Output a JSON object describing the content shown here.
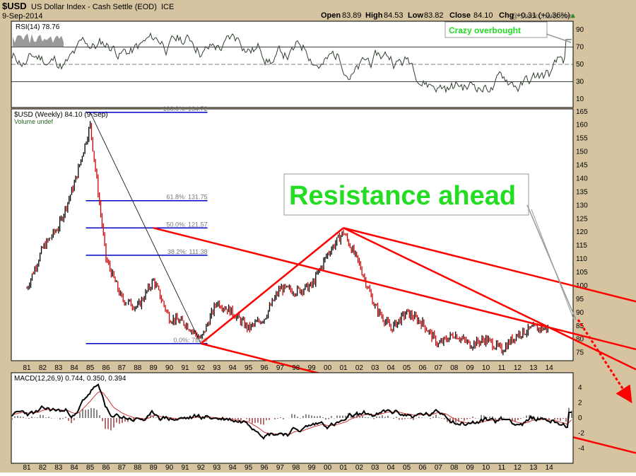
{
  "header": {
    "symbol": "$USD",
    "name": "US Dollar Index - Cash Settle (EOD)",
    "exchange": "ICE",
    "date": "9-Sep-2014",
    "watermark": "@ StockCharts.com",
    "quote": {
      "open_label": "Open",
      "open": "83.89",
      "high_label": "High",
      "high": "84.53",
      "low_label": "Low",
      "low": "83.82",
      "close_label": "Close",
      "close": "84.10",
      "chg_label": "Chg",
      "chg": "+0.31 (+0.36%)"
    }
  },
  "rsi_panel": {
    "label": "RSI(14) 78.76",
    "annotation": "Crazy overbought",
    "ticks": [
      "90",
      "70",
      "50",
      "30",
      "10"
    ]
  },
  "price_panel": {
    "legend": "$USD (Weekly) 84.10 (9-Sep)",
    "volume_label": "Volume undef",
    "annotation": "Resistance ahead",
    "ticks": [
      "165",
      "160",
      "155",
      "150",
      "145",
      "140",
      "135",
      "130",
      "125",
      "120",
      "115",
      "110",
      "105",
      "100",
      "95",
      "90",
      "85",
      "80",
      "75"
    ],
    "fib_levels": [
      {
        "label": "100.0%: 164.72",
        "value": 164.72
      },
      {
        "label": "61.8%: 131.75",
        "value": 131.75
      },
      {
        "label": "50.0%: 121.57",
        "value": 121.57
      },
      {
        "label": "38.2%: 111.38",
        "value": 111.38
      },
      {
        "label": "0.0%: 78.40",
        "value": 78.4
      }
    ]
  },
  "macd_panel": {
    "label": "MACD(12,26,9) 0.744, 0.350, 0.394",
    "ticks": [
      "4",
      "2",
      "0",
      "-2",
      "-4"
    ]
  },
  "x_axis": {
    "labels": [
      "81",
      "82",
      "83",
      "84",
      "85",
      "86",
      "87",
      "88",
      "89",
      "90",
      "91",
      "92",
      "93",
      "94",
      "95",
      "96",
      "97",
      "98",
      "99",
      "00",
      "01",
      "02",
      "03",
      "04",
      "05",
      "06",
      "07",
      "08",
      "09",
      "10",
      "11",
      "12",
      "13",
      "14"
    ]
  },
  "colors": {
    "frame": "#d6c4a0",
    "price_up": "#000000",
    "price_down": "#cc0000",
    "channel": "#ff0000",
    "fib": "#0000cc",
    "annotation_text": "#22dd22",
    "rsi_fill": "#999999"
  },
  "chart_data": {
    "type": "line",
    "title": "$USD US Dollar Index - Cash Settle (EOD)",
    "x": [
      "1981",
      "1982",
      "1983",
      "1984",
      "1985",
      "1986",
      "1987",
      "1988",
      "1989",
      "1990",
      "1991",
      "1992",
      "1993",
      "1994",
      "1995",
      "1996",
      "1997",
      "1998",
      "1999",
      "2000",
      "2001",
      "2002",
      "2003",
      "2004",
      "2005",
      "2006",
      "2007",
      "2008",
      "2009",
      "2010",
      "2011",
      "2012",
      "2013",
      "2014"
    ],
    "series": [
      {
        "name": "$USD (Weekly)",
        "values": [
          99,
          114,
          122,
          138,
          160,
          110,
          95,
          92,
          102,
          88,
          86,
          80,
          94,
          90,
          84,
          88,
          99,
          98,
          100,
          112,
          120,
          108,
          92,
          84,
          90,
          86,
          78,
          82,
          78,
          80,
          76,
          82,
          84,
          84.1
        ]
      }
    ],
    "ylim": [
      72,
      166
    ],
    "fibonacci": [
      {
        "label": "100.0%: 164.72",
        "value": 164.72
      },
      {
        "label": "61.8%: 131.75",
        "value": 131.75
      },
      {
        "label": "50.0%: 121.57",
        "value": 121.57
      },
      {
        "label": "38.2%: 111.38",
        "value": 111.38
      },
      {
        "label": "0.0%: 78.40",
        "value": 78.4
      }
    ],
    "trendlines": [
      {
        "name": "fib-retracement-line",
        "from": [
          "1985",
          164.72
        ],
        "to": [
          "1992",
          78.4
        ]
      },
      {
        "name": "channel-resistance",
        "from": [
          "1989",
          121.57
        ],
        "to": [
          "2014",
          84.4
        ]
      },
      {
        "name": "channel-middle",
        "from": [
          "1992",
          78.4
        ],
        "to": [
          "2001",
          121.57
        ]
      },
      {
        "name": "channel-lower",
        "from": [
          "2001",
          121.57
        ],
        "to": [
          "2014",
          84.4
        ]
      }
    ],
    "rsi": {
      "name": "RSI(14)",
      "last": 78.76,
      "ylim": [
        0,
        100
      ],
      "reference_lines": [
        30,
        50,
        70
      ]
    },
    "macd": {
      "name": "MACD(12,26,9)",
      "values": [
        0.744,
        0.35,
        0.394
      ],
      "ylim": [
        -5,
        5
      ]
    }
  }
}
